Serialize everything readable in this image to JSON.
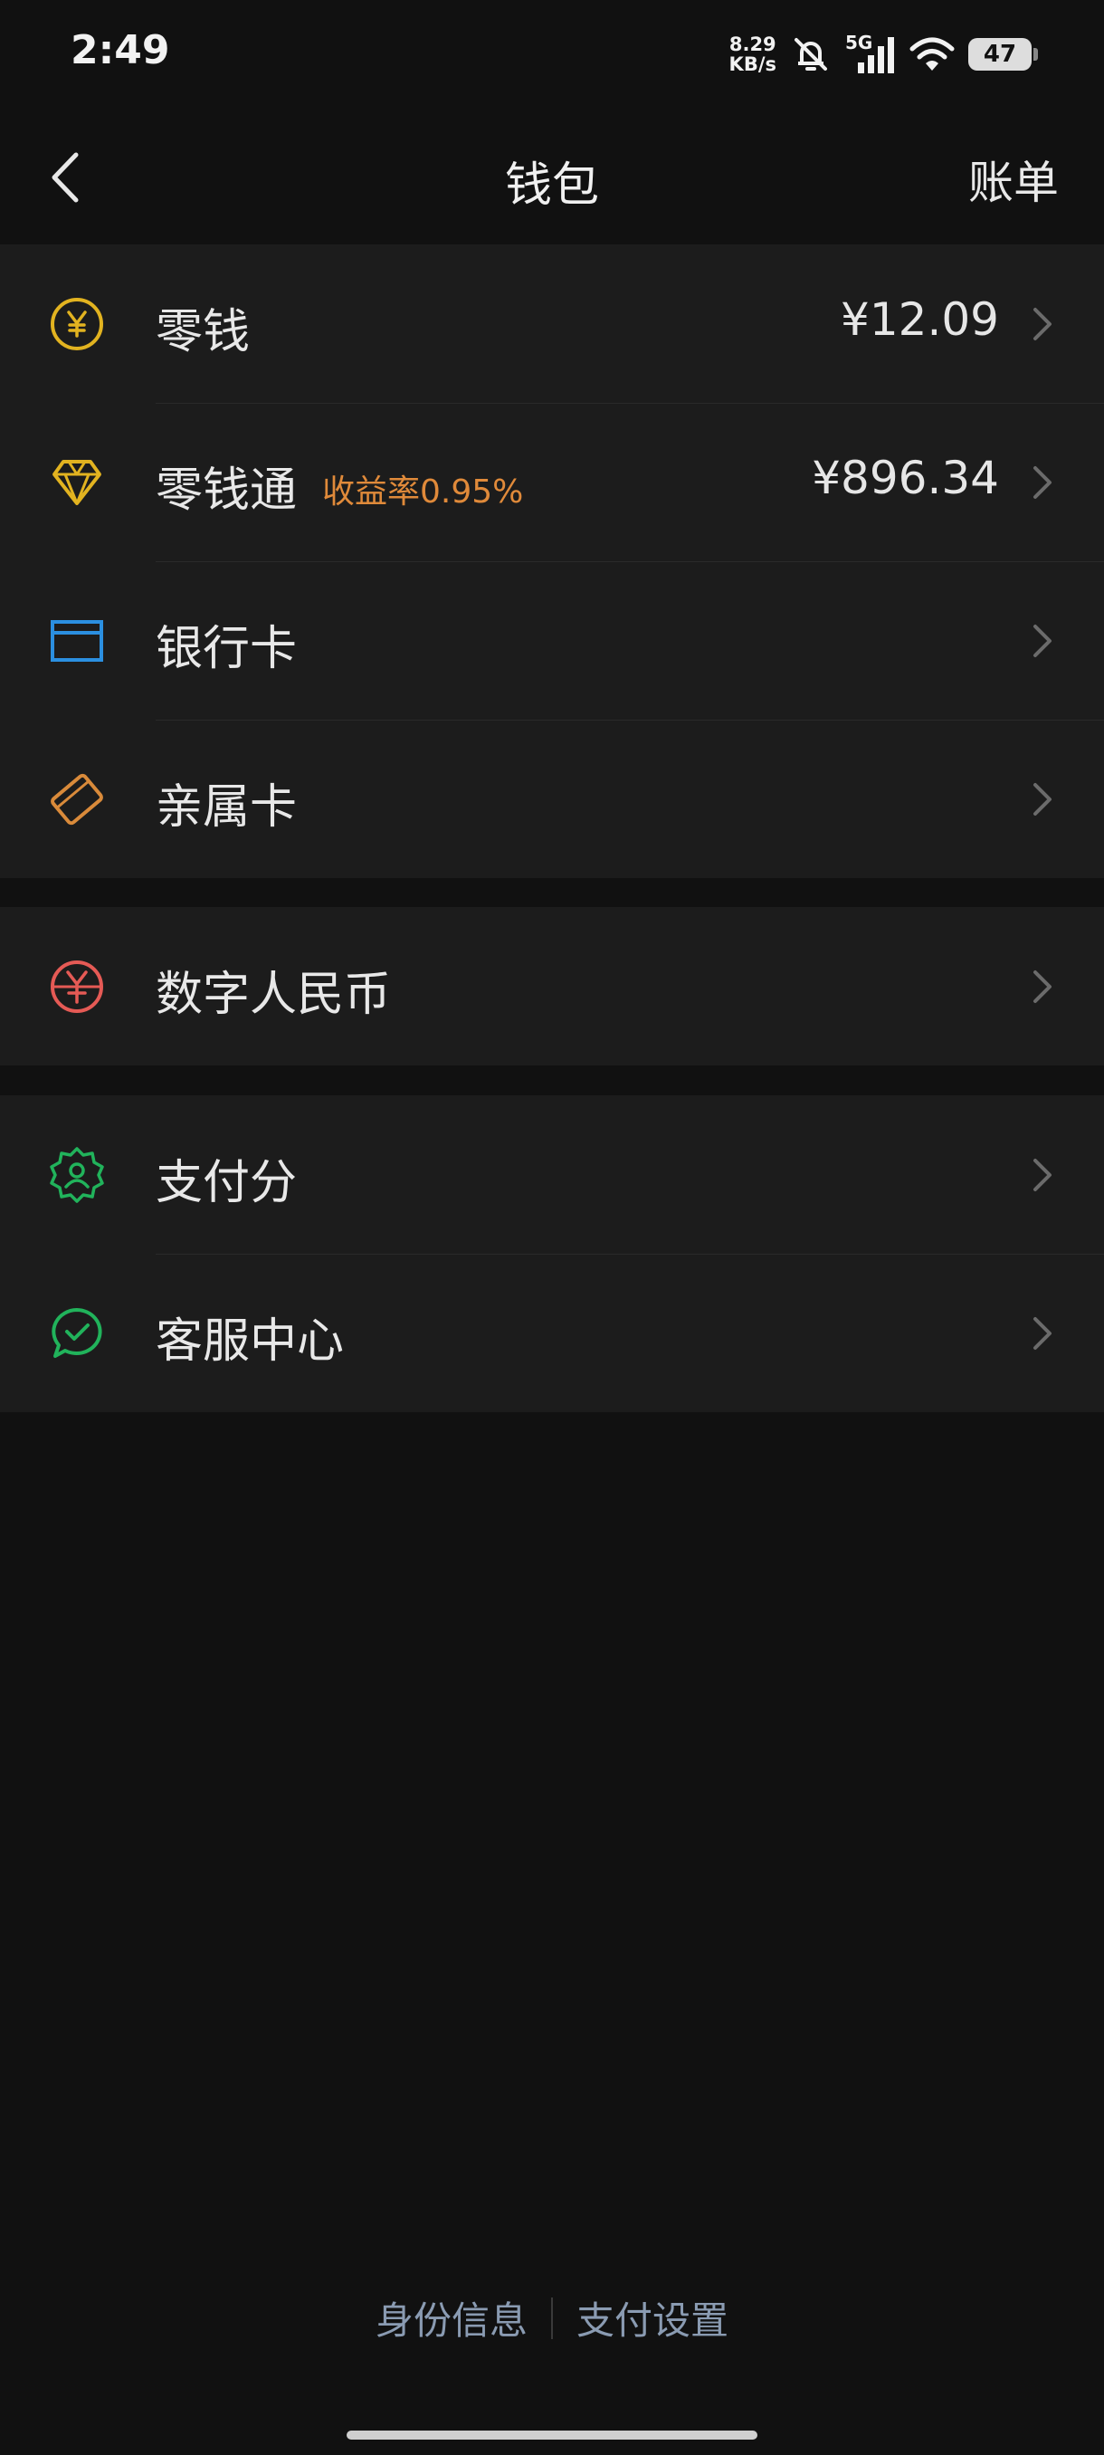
{
  "status": {
    "time": "2:49",
    "net_speed_value": "8.29",
    "net_speed_unit": "KB/s",
    "network": "5G",
    "battery": "47"
  },
  "nav": {
    "title": "钱包",
    "right_action": "账单"
  },
  "groups": [
    {
      "items": [
        {
          "label": "零钱",
          "value": "¥12.09",
          "icon": "yuan-coin-icon",
          "color": "#e2b320"
        },
        {
          "label": "零钱通",
          "badge": "收益率0.95%",
          "value": "¥896.34",
          "icon": "diamond-icon",
          "color": "#e2b320"
        },
        {
          "label": "银行卡",
          "icon": "bank-card-icon",
          "color": "#2b8fe0"
        },
        {
          "label": "亲属卡",
          "icon": "family-card-icon",
          "color": "#d98a3a"
        }
      ]
    },
    {
      "items": [
        {
          "label": "数字人民币",
          "icon": "digital-rmb-icon",
          "color": "#e55a55"
        }
      ]
    },
    {
      "items": [
        {
          "label": "支付分",
          "icon": "pay-score-icon",
          "color": "#21b35b"
        },
        {
          "label": "客服中心",
          "icon": "customer-service-icon",
          "color": "#21b35b"
        }
      ]
    }
  ],
  "footer": {
    "identity": "身份信息",
    "pay_settings": "支付设置"
  },
  "colors": {
    "badge": "#e08a3a",
    "footer_link": "#8a9bb2",
    "background": "#111111",
    "card": "#1c1c1c"
  }
}
